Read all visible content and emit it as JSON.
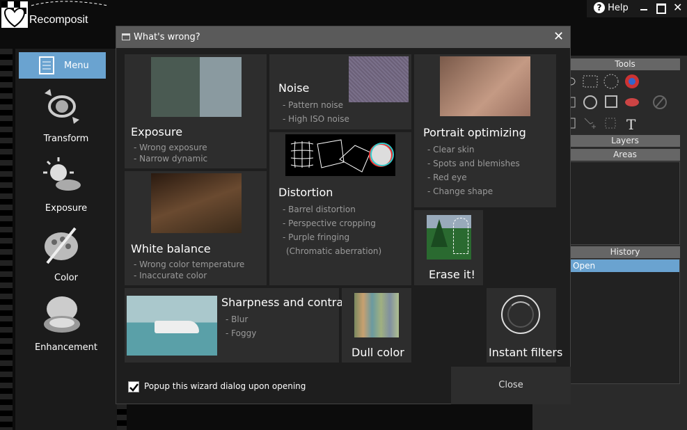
{
  "app": {
    "logo_text": "Recomposit"
  },
  "topbar": {
    "help_label": "Help"
  },
  "sidebar": {
    "menu_label": "Menu",
    "items": [
      {
        "label": "Transform",
        "icon": "transform-icon"
      },
      {
        "label": "Exposure",
        "icon": "sun-cloud-icon"
      },
      {
        "label": "Color",
        "icon": "palette-icon"
      },
      {
        "label": "Enhancement",
        "icon": "compact-mirror-icon"
      }
    ]
  },
  "right_panel": {
    "tools_header": "Tools",
    "layers_header": "Layers",
    "areas_header": "Areas",
    "history_header": "History",
    "history_items": [
      "Open"
    ]
  },
  "dialog": {
    "title": "What's wrong?",
    "tiles": {
      "exposure": {
        "title": "Exposure",
        "items": [
          "- Wrong exposure",
          "- Narrow dynamic"
        ]
      },
      "noise": {
        "title": "Noise",
        "items": [
          "- Pattern noise",
          "- High ISO noise"
        ]
      },
      "portrait": {
        "title": "Portrait optimizing",
        "items": [
          "- Clear skin",
          "- Spots and blemishes",
          "- Red eye",
          "- Change shape"
        ]
      },
      "white_balance": {
        "title": "White balance",
        "items": [
          "- Wrong color temperature",
          "- Inaccurate color"
        ]
      },
      "distortion": {
        "title": "Distortion",
        "items": [
          "- Barrel distortion",
          "- Perspective cropping",
          "- Purple fringing",
          "(Chromatic aberration)"
        ]
      },
      "erase": {
        "title": "Erase it!"
      },
      "sharpness": {
        "title": "Sharpness and contrast",
        "items": [
          "- Blur",
          "- Foggy"
        ]
      },
      "dull": {
        "title": "Dull color"
      },
      "instant": {
        "title": "Instant filters"
      }
    },
    "checkbox_label": "Popup this wizard dialog upon opening",
    "checkbox_checked": true,
    "close_label": "Close"
  },
  "colors": {
    "accent": "#6aa3d0",
    "dialog_bg": "#1e1e1e",
    "tile_bg": "#2d2d2d",
    "title_bar": "#5a5a5a"
  }
}
